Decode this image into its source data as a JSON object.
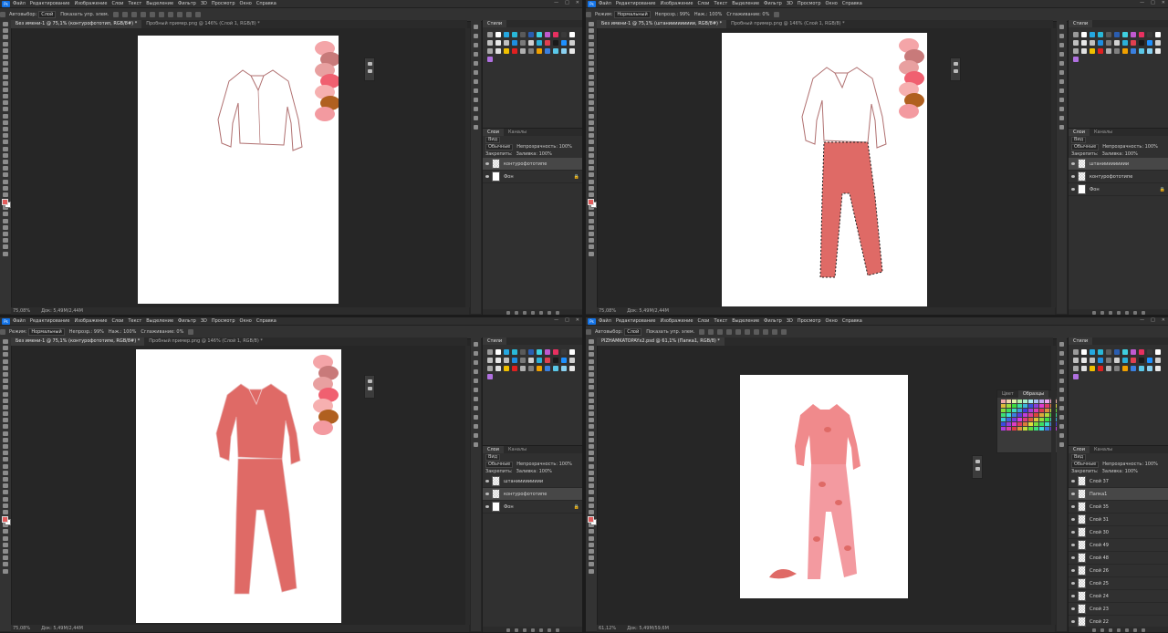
{
  "menu": {
    "logo": "Ps",
    "items": [
      "Файл",
      "Редактирование",
      "Изображение",
      "Слои",
      "Текст",
      "Выделение",
      "Фильтр",
      "3D",
      "Просмотр",
      "Окно",
      "Справка"
    ],
    "window_controls": [
      "—",
      "□",
      "✕"
    ]
  },
  "quadrants": [
    {
      "options": {
        "autoselect": "Автовыбор:",
        "target": "Слой",
        "transform": "Показать упр. элем."
      },
      "doc_tabs": [
        {
          "label": "Без имени-1 @ 75,1% (контурофототип, RGB/8#) *",
          "active": true
        },
        {
          "label": "Пробный пример.png @ 146% (Слой 1, RGB/8) *",
          "active": false
        }
      ],
      "status": {
        "zoom": "75,08%",
        "doc": "Док: 5,49M/2,44M"
      },
      "layers": [
        "контурофототипе",
        "Фон"
      ],
      "selected_layer": 0
    },
    {
      "options": {
        "mode_label": "Режим:",
        "mode": "Нормальный",
        "opacity": "Непрозр.: 99%",
        "flow": "Наж.: 100%",
        "smoothing": "Сглаживание: 0%"
      },
      "doc_tabs": [
        {
          "label": "Без имени-1 @ 75,1% (штаниииииииии, RGB/8#) *",
          "active": true
        },
        {
          "label": "Пробный пример.png @ 146% (Слой 1, RGB/8) *",
          "active": false
        }
      ],
      "status": {
        "zoom": "75,08%",
        "doc": "Док: 5,49M/2,44M"
      },
      "layers": [
        "штаниииииииии",
        "контурофототипе",
        "Фон"
      ],
      "selected_layer": 0
    },
    {
      "options": {
        "mode_label": "Режим:",
        "mode": "Нормальный",
        "opacity": "Непрозр.: 99%",
        "flow": "Наж.: 100%",
        "smoothing": "Сглаживание: 0%"
      },
      "doc_tabs": [
        {
          "label": "Без имени-1 @ 75,1% (контурофототипе, RGB/8#) *",
          "active": true
        },
        {
          "label": "Пробный пример.png @ 146% (Слой 1, RGB/8) *",
          "active": false
        }
      ],
      "status": {
        "zoom": "75,08%",
        "doc": "Док: 5,49M/2,44M"
      },
      "layers": [
        "штаниииииииии",
        "контурофототипе",
        "Фон"
      ],
      "selected_layer": 1
    },
    {
      "options": {
        "autoselect": "Автовыбор:",
        "target": "Слой",
        "transform": "Показать упр. элем."
      },
      "doc_tabs": [
        {
          "label": "PIZHAMKATOPAYx2.psd @ 61,1% (Папка1, RGB/8) *",
          "active": true
        }
      ],
      "status": {
        "zoom": "61,12%",
        "doc": "Док: 5,49M/59,6M"
      },
      "layers": [
        "Слой 37",
        "Папка1",
        "Слой 35",
        "Слой 31",
        "Слой 30",
        "Слой 49",
        "Слой 48",
        "Слой 26",
        "Слой 25",
        "Слой 24",
        "Слой 23",
        "Слой 22",
        "Слой 21"
      ],
      "selected_layer": 1
    }
  ],
  "panels": {
    "swatches_tab": "Стили",
    "layers_tab": "Слои",
    "channels_tab": "Каналы",
    "kind": "Вид",
    "blend": "Обычные",
    "opacity": "Непрозрачность: 100%",
    "lock": "Закрепить:",
    "fill": "Заливка: 100%",
    "palette_tabs": [
      "Цвет",
      "Образцы"
    ]
  },
  "swatch_colors": [
    "#9a9a9a",
    "#ffffff",
    "#25a7e0",
    "#29b8d8",
    "#5a5a5a",
    "#2a5db0",
    "#3fd0e0",
    "#c05ad0",
    "#e83060",
    "#3a3a3a",
    "#ffffff",
    "#c0c0c0",
    "#e8e8e8",
    "#c0c0c0",
    "#1e8ee0",
    "#7a7a7a",
    "#d0d0d0",
    "#2cb0d8",
    "#e04050",
    "#1a1a1a",
    "#1e90ff",
    "#d0d0d0",
    "#a8a8a8",
    "#e0e0e0",
    "#f0c000",
    "#e02020",
    "#b0b0b0",
    "#808080",
    "#f0a000",
    "#3a80e0",
    "#5ac8e8",
    "#8ad0f0",
    "#e8e8e8",
    "#b070e0"
  ],
  "sketch_palette": [
    "#f4a5a8",
    "#c87a7a",
    "#e8a0a0",
    "#f06070",
    "#f6b0b0",
    "#b06020",
    "#f39aa0"
  ],
  "colors": {
    "fabric": "#df6a66",
    "fabric_light": "#f08a8c",
    "outline": "#b07070",
    "accent_fg": "#e25c5c"
  }
}
